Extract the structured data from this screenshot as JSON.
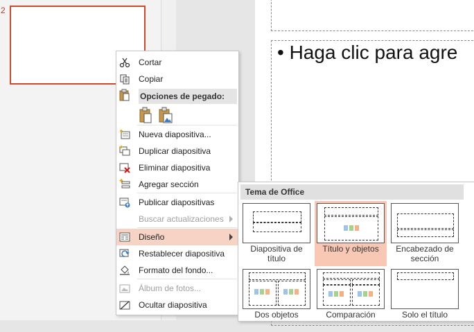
{
  "thumbnail": {
    "slide_number": "2"
  },
  "slide": {
    "body_text": "• Haga clic para agre"
  },
  "context_menu": {
    "items": [
      {
        "label": "Cortar",
        "icon": "scissors-icon",
        "disabled": false
      },
      {
        "label": "Copiar",
        "icon": "copy-icon",
        "disabled": false
      },
      {
        "label": "Opciones de pegado:",
        "type": "header"
      },
      {
        "paste_options": [
          "paste-keep-format-icon",
          "paste-picture-icon"
        ]
      },
      {
        "label": "Nueva diapositiva...",
        "icon": "new-slide-icon",
        "disabled": false
      },
      {
        "label": "Duplicar diapositiva",
        "icon": "duplicate-slide-icon",
        "disabled": false
      },
      {
        "label": "Eliminar diapositiva",
        "icon": "delete-slide-icon",
        "disabled": false
      },
      {
        "label": "Agregar sección",
        "icon": "add-section-icon",
        "disabled": false
      },
      {
        "label": "Publicar diapositivas",
        "icon": "publish-slides-icon",
        "disabled": false
      },
      {
        "label": "Buscar actualizaciones",
        "icon": "",
        "disabled": true
      },
      {
        "label": "Diseño",
        "icon": "layout-icon",
        "disabled": false,
        "highlighted": true,
        "submenu": true
      },
      {
        "label": "Restablecer diapositiva",
        "icon": "reset-slide-icon",
        "disabled": false
      },
      {
        "label": "Formato del fondo...",
        "icon": "format-background-icon",
        "disabled": false
      },
      {
        "label": "Álbum de fotos...",
        "icon": "photo-album-icon",
        "disabled": true
      },
      {
        "label": "Ocultar diapositiva",
        "icon": "hide-slide-icon",
        "disabled": false
      }
    ]
  },
  "layout_submenu": {
    "header": "Tema de Office",
    "layouts": [
      {
        "caption": "Diapositiva de título",
        "selected": false
      },
      {
        "caption": "Título y objetos",
        "selected": true
      },
      {
        "caption": "Encabezado de sección",
        "selected": false
      },
      {
        "caption": "Dos objetos",
        "selected": false
      },
      {
        "caption": "Comparación",
        "selected": false
      },
      {
        "caption": "Solo el título",
        "selected": false
      }
    ]
  },
  "colors": {
    "accent": "#d24726",
    "highlight": "#f7d3c5",
    "selected_layout": "#f9c8b4"
  }
}
